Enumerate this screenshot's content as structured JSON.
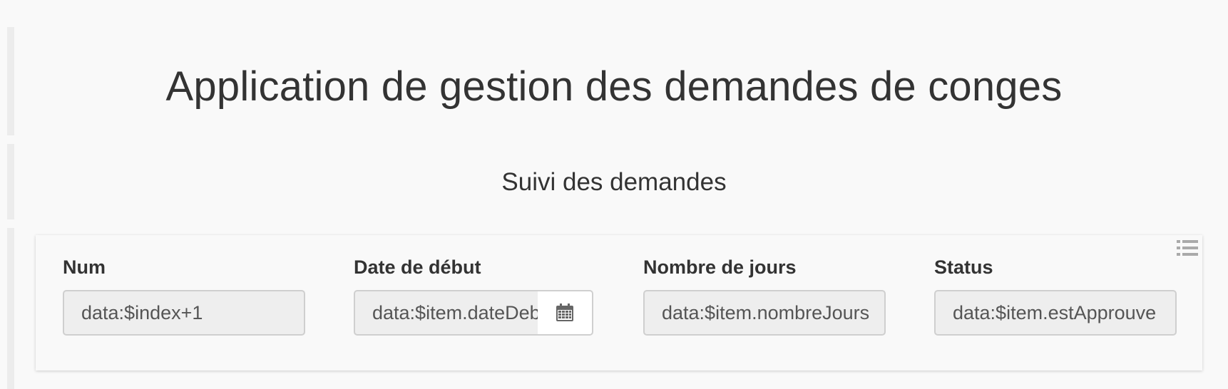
{
  "app": {
    "title": "Application de gestion des demandes de conges",
    "subtitle": "Suivi des demandes"
  },
  "table": {
    "menu_icon": "list-icon",
    "columns": [
      {
        "label": "Num",
        "value": "data:$index+1"
      },
      {
        "label": "Date de début",
        "value": "data:$item.dateDebut",
        "icon": "calendar-icon"
      },
      {
        "label": "Nombre de jours",
        "value": "data:$item.nombreJours"
      },
      {
        "label": "Status",
        "value": "data:$item.estApprouve"
      }
    ]
  }
}
